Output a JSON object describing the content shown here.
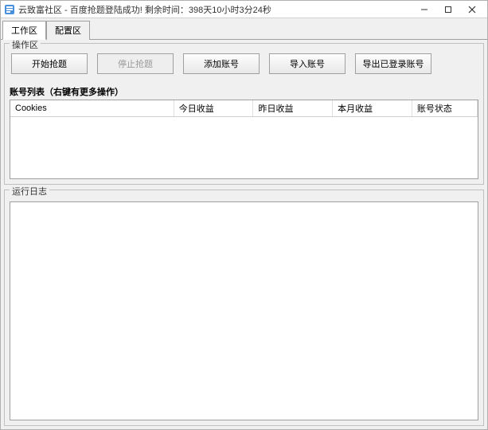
{
  "window": {
    "title": "云致富社区 - 百度抢题登陆成功! 剩余时间：398天10小时3分24秒"
  },
  "tabs": [
    {
      "label": "工作区",
      "active": true
    },
    {
      "label": "配置区",
      "active": false
    }
  ],
  "operationArea": {
    "title": "操作区",
    "buttons": {
      "start": "开始抢题",
      "stop": "停止抢题",
      "add": "添加账号",
      "import": "导入账号",
      "export": "导出已登录账号"
    }
  },
  "accountList": {
    "label": "账号列表（右键有更多操作）",
    "columns": [
      "Cookies",
      "今日收益",
      "昨日收益",
      "本月收益",
      "账号状态"
    ]
  },
  "log": {
    "title": "运行日志"
  }
}
